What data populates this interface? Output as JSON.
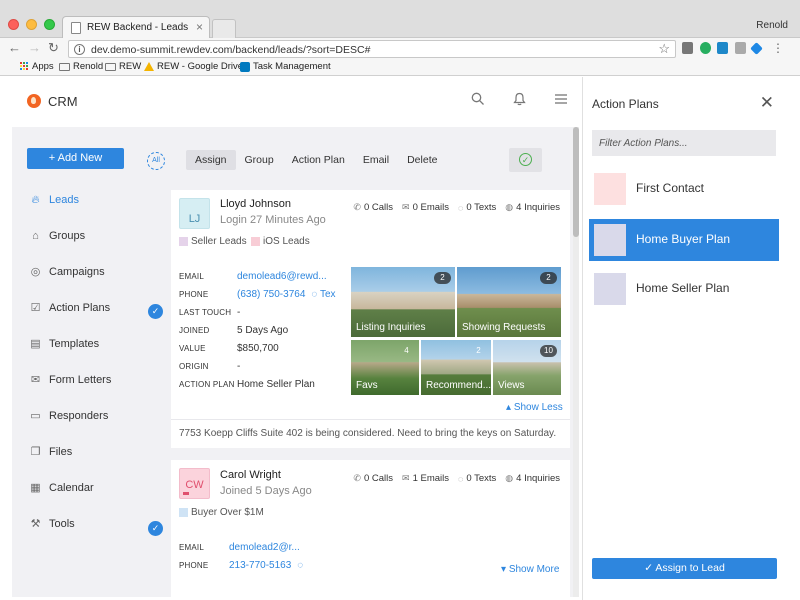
{
  "browser": {
    "tab_title": "REW Backend - Leads",
    "tab_close": "×",
    "profile": "Renold",
    "url": "dev.demo-summit.rewdev.com/backend/leads/?sort=DESC#",
    "bookmarks": [
      "Apps",
      "Renold",
      "REW",
      "REW - Google Drive",
      "Task Management"
    ]
  },
  "header": {
    "title": "CRM"
  },
  "sidebar": {
    "add_new": "+ Add New",
    "all_badge": "All",
    "items": [
      {
        "label": "Leads",
        "icon": "flame-icon"
      },
      {
        "label": "Groups",
        "icon": "tag-icon"
      },
      {
        "label": "Campaigns",
        "icon": "target-icon"
      },
      {
        "label": "Action Plans",
        "icon": "checkbox-icon"
      },
      {
        "label": "Templates",
        "icon": "template-icon"
      },
      {
        "label": "Form Letters",
        "icon": "mail-icon"
      },
      {
        "label": "Responders",
        "icon": "responder-icon"
      },
      {
        "label": "Files",
        "icon": "files-icon"
      },
      {
        "label": "Calendar",
        "icon": "calendar-icon"
      },
      {
        "label": "Tools",
        "icon": "tools-icon"
      }
    ]
  },
  "toolbar": {
    "actions": [
      "Assign",
      "Group",
      "Action Plan",
      "Email",
      "Delete"
    ],
    "selected": "Assign"
  },
  "leads": [
    {
      "initials": "LJ",
      "avatar_color": "#d6eef3",
      "name": "Lloyd Johnson",
      "subtitle": "Login 27 Minutes Ago",
      "stats": {
        "calls": "0 Calls",
        "emails": "0 Emails",
        "texts": "0 Texts",
        "inquiries": "4 Inquiries"
      },
      "tags": [
        {
          "label": "Seller Leads",
          "color": "#e5d3ea"
        },
        {
          "label": "iOS Leads",
          "color": "#f8cdd6"
        }
      ],
      "info": {
        "email_key": "EMAIL",
        "email": "demolead6@rewd...",
        "phone_key": "PHONE",
        "phone": "(638) 750-3764",
        "text_link": "Tex",
        "last_touch_key": "LAST TOUCH",
        "last_touch": "-",
        "joined_key": "JOINED",
        "joined": "5 Days Ago",
        "value_key": "VALUE",
        "value": "$850,700",
        "origin_key": "ORIGIN",
        "origin": "-",
        "action_plan_key": "ACTION PLAN",
        "action_plan": "Home Seller Plan"
      },
      "tiles": [
        {
          "label": "Listing Inquiries",
          "count": "2"
        },
        {
          "label": "Showing Requests",
          "count": "2"
        },
        {
          "label": "Favs",
          "count": "4"
        },
        {
          "label": "Recommend...",
          "count": "2"
        },
        {
          "label": "Views",
          "count": "10"
        }
      ],
      "show_toggle": "Show Less",
      "note": "7753 Koepp Cliffs Suite 402 is being considered. Need to bring the keys on Saturday."
    },
    {
      "initials": "CW",
      "avatar_color": "#fbd3dc",
      "name": "Carol Wright",
      "subtitle": "Joined 5 Days Ago",
      "stats": {
        "calls": "0 Calls",
        "emails": "1 Emails",
        "texts": "0 Texts",
        "inquiries": "4 Inquiries"
      },
      "tags": [
        {
          "label": "Buyer Over $1M",
          "color": "#cfe3f5"
        }
      ],
      "info": {
        "email_key": "EMAIL",
        "email": "demolead2@r...",
        "phone_key": "PHONE",
        "phone": "213-770-5163"
      },
      "show_toggle": "Show More"
    }
  ],
  "action_plans_panel": {
    "title": "Action Plans",
    "filter_placeholder": "Filter Action Plans...",
    "plans": [
      {
        "label": "First Contact",
        "color": "#fde0e0",
        "selected": false
      },
      {
        "label": "Home Buyer Plan",
        "color": "#d9d9ea",
        "selected": true
      },
      {
        "label": "Home Seller Plan",
        "color": "#d9d9ea",
        "selected": false
      }
    ],
    "assign_button": "Assign to Lead"
  }
}
